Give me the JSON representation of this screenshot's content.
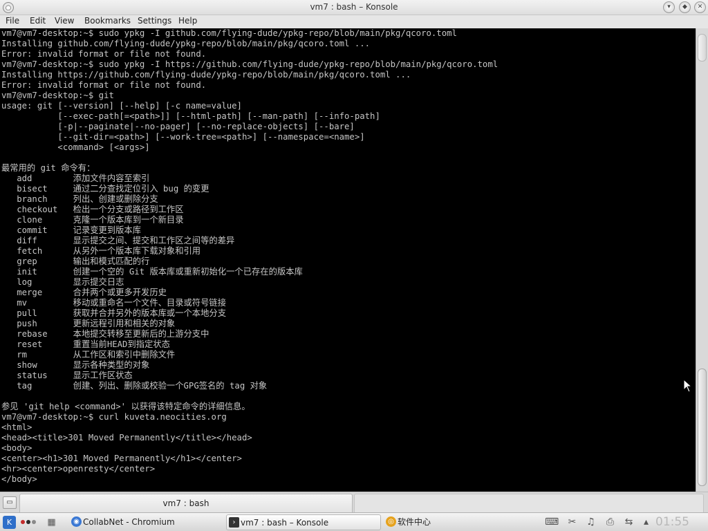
{
  "window": {
    "title": "vm7 : bash – Konsole",
    "min_icon": "chevron-down-icon",
    "max_icon": "chevron-up-icon",
    "close_icon": "close-icon"
  },
  "menu": {
    "file": "File",
    "edit": "Edit",
    "view": "View",
    "bookmarks": "Bookmarks",
    "settings": "Settings",
    "help": "Help"
  },
  "terminal": {
    "lines": [
      "vm7@vm7-desktop:~$ sudo ypkg -I github.com/flying-dude/ypkg-repo/blob/main/pkg/qcoro.toml",
      "Installing github.com/flying-dude/ypkg-repo/blob/main/pkg/qcoro.toml ...",
      "Error: invalid format or file not found.",
      "vm7@vm7-desktop:~$ sudo ypkg -I https://github.com/flying-dude/ypkg-repo/blob/main/pkg/qcoro.toml",
      "Installing https://github.com/flying-dude/ypkg-repo/blob/main/pkg/qcoro.toml ...",
      "Error: invalid format or file not found.",
      "vm7@vm7-desktop:~$ git",
      "usage: git [--version] [--help] [-c name=value]",
      "           [--exec-path[=<path>]] [--html-path] [--man-path] [--info-path]",
      "           [-p|--paginate|--no-pager] [--no-replace-objects] [--bare]",
      "           [--git-dir=<path>] [--work-tree=<path>] [--namespace=<name>]",
      "           <command> [<args>]",
      "",
      "最常用的 git 命令有：",
      "   add        添加文件内容至索引",
      "   bisect     通过二分查找定位引入 bug 的变更",
      "   branch     列出、创建或删除分支",
      "   checkout   检出一个分支或路径到工作区",
      "   clone      克隆一个版本库到一个新目录",
      "   commit     记录变更到版本库",
      "   diff       显示提交之间、提交和工作区之间等的差异",
      "   fetch      从另外一个版本库下载对象和引用",
      "   grep       输出和模式匹配的行",
      "   init       创建一个空的 Git 版本库或重新初始化一个已存在的版本库",
      "   log        显示提交日志",
      "   merge      合并两个或更多开发历史",
      "   mv         移动或重命名一个文件、目录或符号链接",
      "   pull       获取并合并另外的版本库或一个本地分支",
      "   push       更新远程引用和相关的对象",
      "   rebase     本地提交转移至更新后的上游分支中",
      "   reset      重置当前HEAD到指定状态",
      "   rm         从工作区和索引中删除文件",
      "   show       显示各种类型的对象",
      "   status     显示工作区状态",
      "   tag        创建、列出、删除或校验一个GPG签名的 tag 对象",
      "",
      "参见 'git help <command>' 以获得该特定命令的详细信息。",
      "vm7@vm7-desktop:~$ curl kuveta.neocities.org",
      "<html>",
      "<head><title>301 Moved Permanently</title></head>",
      "<body>",
      "<center><h1>301 Moved Permanently</h1></center>",
      "<hr><center>openresty</center>",
      "</body>"
    ]
  },
  "tabs": {
    "active_label": "vm7 : bash",
    "new_tab_icon": "new-tab-icon"
  },
  "taskbar": {
    "launcher_icon": "kde-launcher-icon",
    "tasks": [
      {
        "label": "CollabNet - Chromium",
        "icon": "chromium-icon"
      },
      {
        "label": "vm7 : bash – Konsole",
        "icon": "terminal-icon"
      },
      {
        "label": "软件中心",
        "icon": "software-center-icon"
      }
    ],
    "clock": "01:55",
    "colors": {
      "dot1": "#c42b2b",
      "dot2": "#2a2a2a",
      "dot3": "#8a8a8a"
    }
  }
}
